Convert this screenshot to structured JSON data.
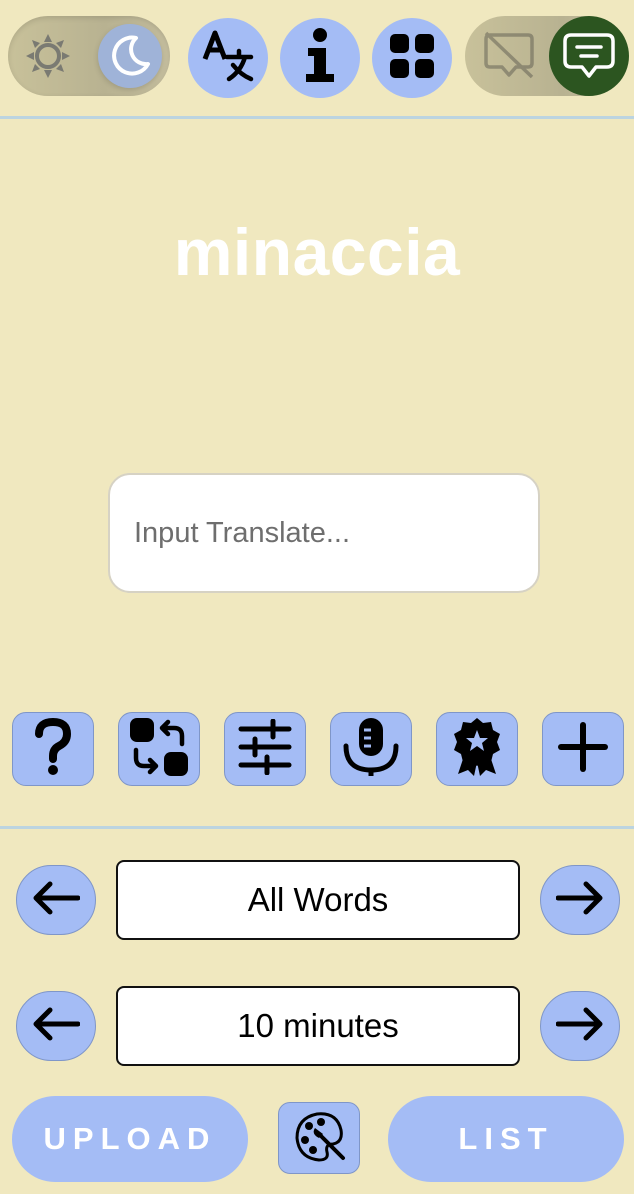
{
  "header": {
    "theme_toggle": {
      "left_icon": "sun-icon",
      "right_icon": "moon-icon",
      "selected": "dark"
    },
    "buttons": [
      {
        "name": "translate-button",
        "icon": "translate-icon"
      },
      {
        "name": "info-button",
        "icon": "info-icon"
      },
      {
        "name": "apps-button",
        "icon": "grid-icon"
      }
    ],
    "chat_toggle": {
      "left_icon": "chat-off-icon",
      "right_icon": "chat-icon",
      "selected": "on"
    }
  },
  "main": {
    "word": "minaccia",
    "input": {
      "placeholder": "Input Translate...",
      "value": ""
    }
  },
  "tools": [
    {
      "name": "help-button",
      "icon": "question-mark-icon"
    },
    {
      "name": "swap-button",
      "icon": "swap-icon"
    },
    {
      "name": "settings-button",
      "icon": "sliders-icon"
    },
    {
      "name": "microphone-button",
      "icon": "microphone-icon"
    },
    {
      "name": "badge-button",
      "icon": "badge-icon"
    },
    {
      "name": "add-button",
      "icon": "plus-icon"
    }
  ],
  "selectors": {
    "word_set": {
      "value": "All Words"
    },
    "duration": {
      "value": "10 minutes"
    }
  },
  "footer": {
    "upload_label": "UPLOAD",
    "palette_icon": "palette-icon",
    "list_label": "LIST"
  },
  "colors": {
    "background": "#f0e8bf",
    "button": "#a4bcf5",
    "chat_active": "#2c5520",
    "divider": "#bcd4e0"
  }
}
